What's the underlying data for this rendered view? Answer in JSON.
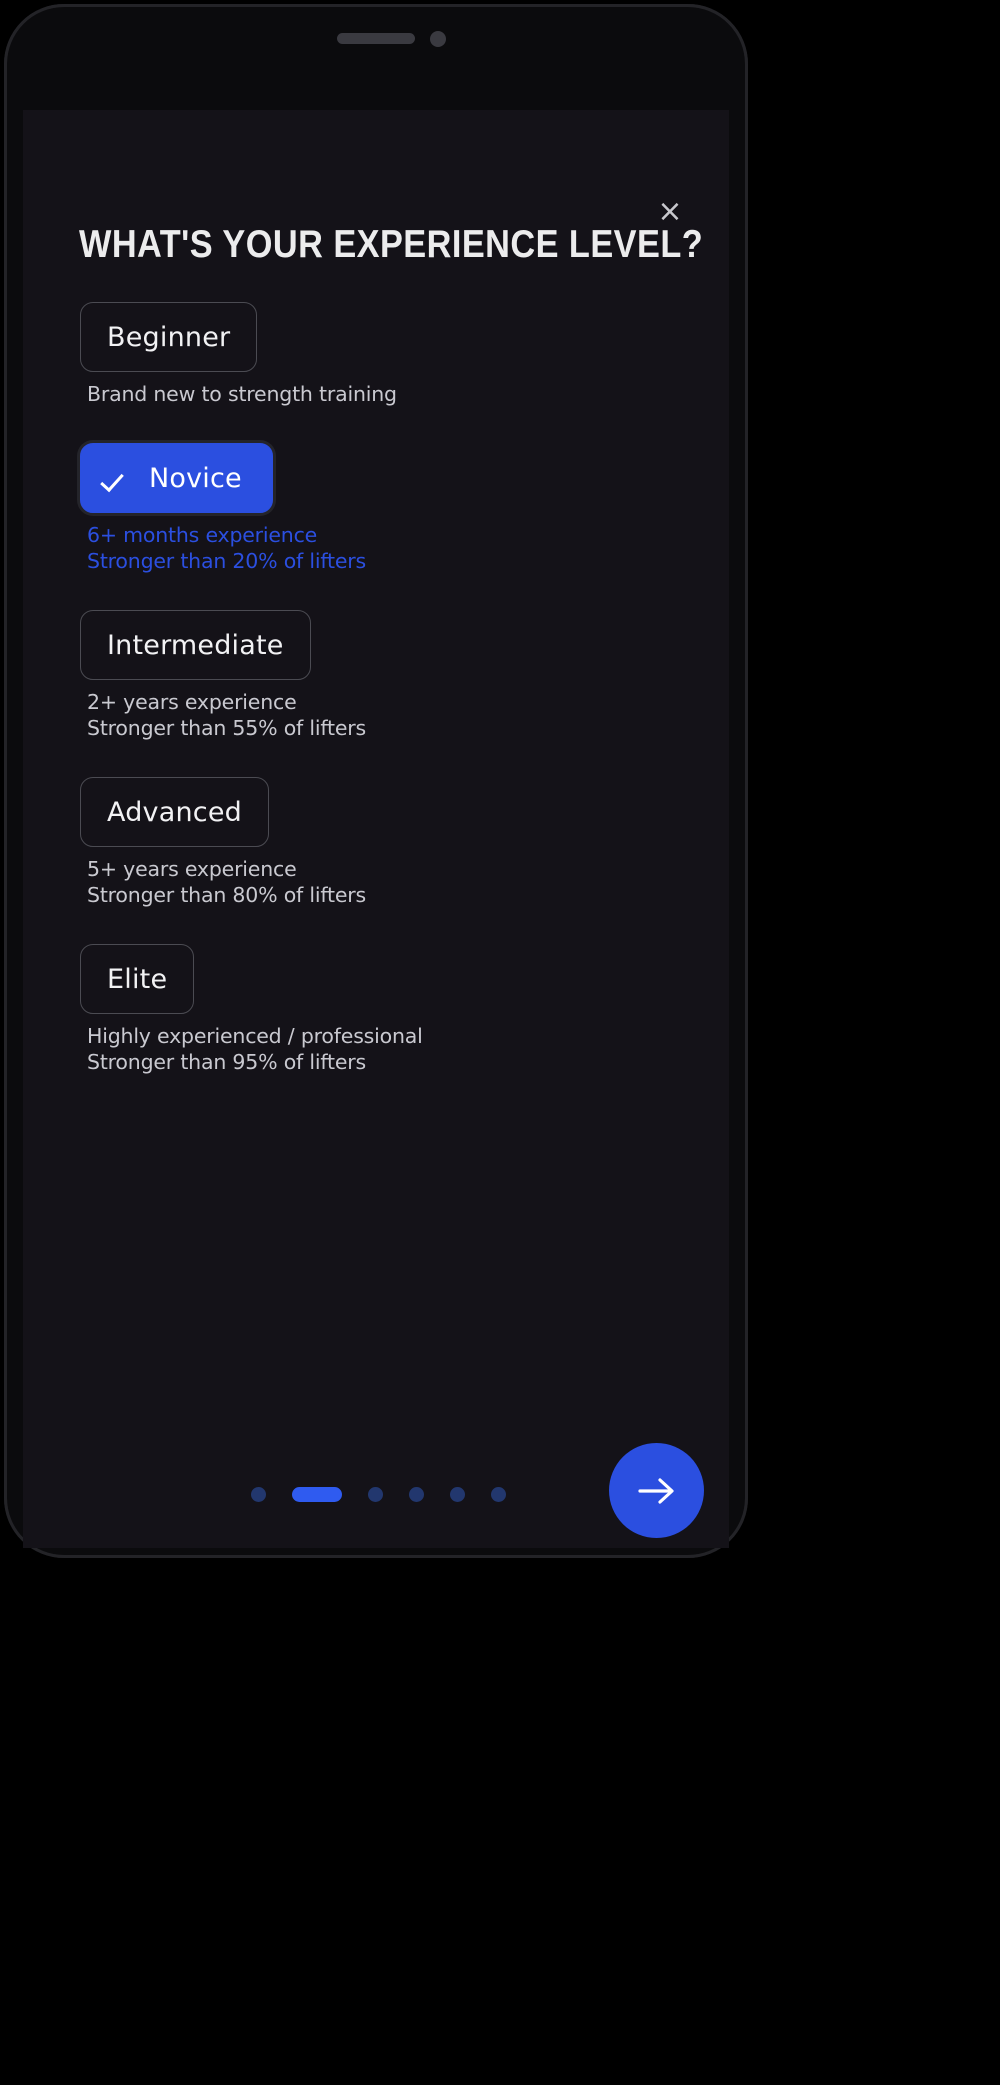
{
  "device": {
    "speaker_icon": "speaker-grille",
    "camera_icon": "front-camera"
  },
  "screen": {
    "background_color": "#141218",
    "accent_color": "#2b4fe0"
  },
  "header": {
    "title": "WHAT'S YOUR EXPERIENCE LEVEL?",
    "close_icon": "close-icon",
    "close_label": "×"
  },
  "options": [
    {
      "label": "Beginner",
      "selected": false,
      "desc_lines": [
        "Brand new to strength training"
      ]
    },
    {
      "label": "Novice",
      "selected": true,
      "check_icon": "check-icon",
      "desc_lines": [
        "6+ months experience",
        "Stronger than 20% of lifters"
      ]
    },
    {
      "label": "Intermediate",
      "selected": false,
      "desc_lines": [
        "2+ years experience",
        "Stronger than 55% of lifters"
      ]
    },
    {
      "label": "Advanced",
      "selected": false,
      "desc_lines": [
        "5+ years experience",
        "Stronger than 80% of lifters"
      ]
    },
    {
      "label": "Elite",
      "selected": false,
      "desc_lines": [
        "Highly experienced / professional",
        "Stronger than 95% of lifters"
      ]
    }
  ],
  "pagination": {
    "total": 6,
    "active_index": 1,
    "active_color": "#2f5bf0",
    "inactive_color": "#22376e"
  },
  "next_button": {
    "icon": "arrow-right-icon",
    "color": "#2b4fe0"
  }
}
